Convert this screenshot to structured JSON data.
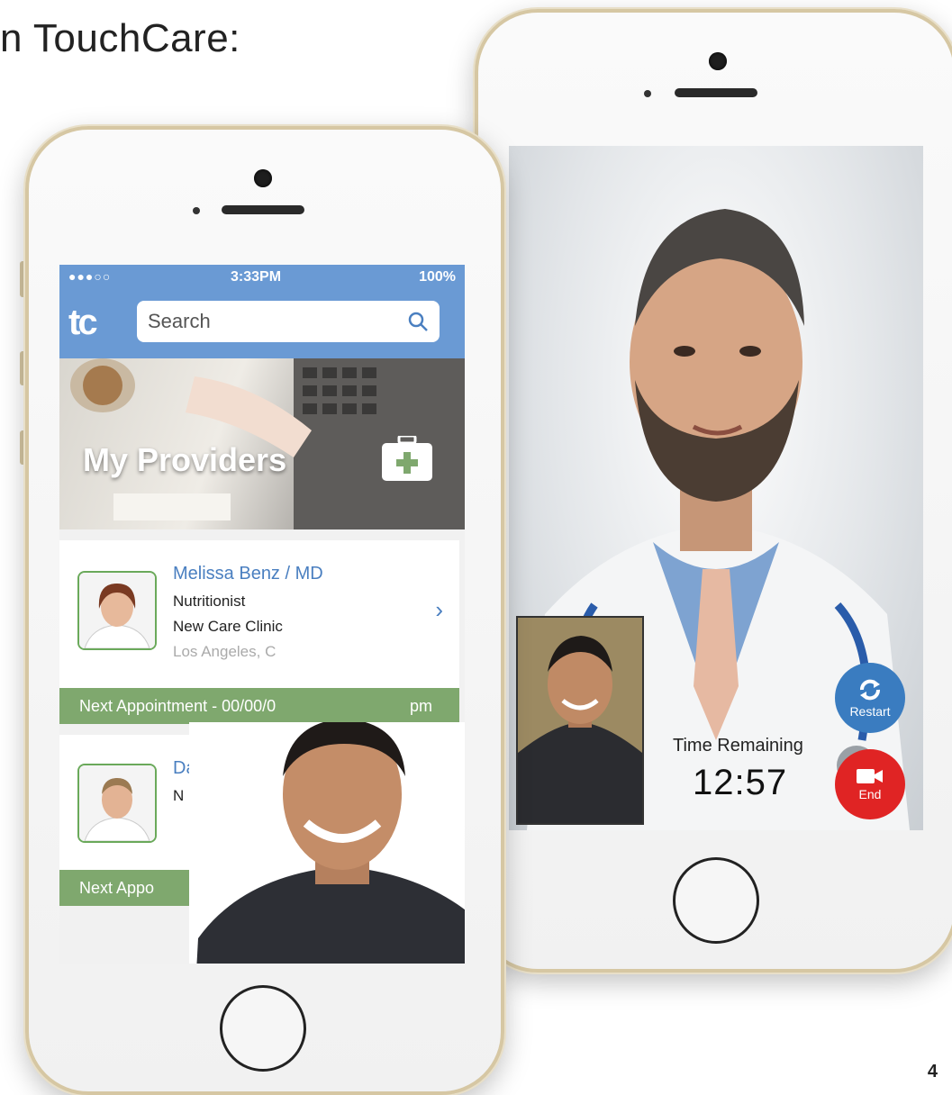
{
  "slide": {
    "title": "n TouchCare:",
    "page_number": "4"
  },
  "left_phone": {
    "status_bar": {
      "carrier": "●●●○○",
      "time": "3:33PM",
      "battery": "100%"
    },
    "nav": {
      "logo": "tc",
      "search_placeholder": "Search"
    },
    "hero": {
      "title": "My Providers"
    },
    "providers": [
      {
        "name": "Melissa Benz / MD",
        "specialty": "Nutritionist",
        "clinic": "New Care Clinic",
        "location": "Los Angeles, C",
        "next_appointment": "Next Appointment - 00/00/0",
        "next_appointment_tail": "pm"
      },
      {
        "name": "Da",
        "specialty": "N",
        "next_appointment": "Next Appo"
      }
    ]
  },
  "right_phone": {
    "call": {
      "time_remaining_label": "Time Remaining",
      "time_remaining": "12:57"
    },
    "buttons": {
      "restart": "Restart",
      "end": "End"
    }
  },
  "colors": {
    "accent_blue": "#6a9ad4",
    "appointment_green": "#7fa86e",
    "end_red": "#e02424",
    "restart_blue": "#3a7cc0"
  }
}
